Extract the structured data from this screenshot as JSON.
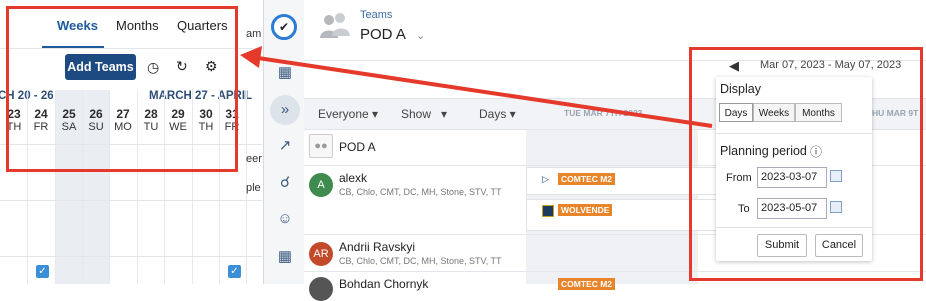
{
  "left_panel": {
    "tabs": [
      {
        "label": "Weeks",
        "active": true
      },
      {
        "label": "Months",
        "active": false
      },
      {
        "label": "Quarters",
        "active": false
      }
    ],
    "add_teams_label": "Add Teams",
    "icons": [
      "clock-icon",
      "refresh-icon",
      "gear-icon"
    ],
    "range_left": "CH 20 - 26",
    "range_right": "MARCH 27 - APRIL",
    "days": [
      {
        "n": "23",
        "w": "TH"
      },
      {
        "n": "24",
        "w": "FR"
      },
      {
        "n": "25",
        "w": "SA"
      },
      {
        "n": "26",
        "w": "SU"
      },
      {
        "n": "27",
        "w": "MO"
      },
      {
        "n": "28",
        "w": "TU"
      },
      {
        "n": "29",
        "w": "WE"
      },
      {
        "n": "30",
        "w": "TH"
      },
      {
        "n": "31",
        "w": "FR"
      }
    ],
    "edge_texts": [
      "am",
      "eer",
      "ple"
    ]
  },
  "sidebar": {
    "icons": [
      "app-logo-icon",
      "calendar-icon",
      "chevrons-right-icon",
      "chart-icon",
      "share-nodes-icon",
      "user-circle-icon",
      "grid-icon"
    ]
  },
  "header": {
    "breadcrumb": "Teams",
    "title": "POD A"
  },
  "date_range": "Mar 07, 2023 - May 07, 2023",
  "toolbar": {
    "everyone": "Everyone",
    "show": "Show",
    "days": "Days",
    "col_1": "TUE MAR 7TH 2023",
    "col_2": "HU MAR 9T"
  },
  "team_row": {
    "name": "POD A"
  },
  "people": [
    {
      "initial": "A",
      "name": "alexk",
      "skills": "CB, Chlo, CMT, DC, MH, Stone, STV, TT",
      "color": "#3f8a4f",
      "tags": [
        "COMTEC M2",
        "WOLVENDE"
      ]
    },
    {
      "initial": "AR",
      "name": "Andrii Ravskyi",
      "skills": "CB, Chlo, CMT, DC, MH, Stone, STV, TT",
      "color": "#c24a2a",
      "tags": []
    },
    {
      "initial": "",
      "name": "Bohdan Chornyk",
      "skills": "",
      "color": "#555",
      "tags": [
        "COMTEC M2"
      ]
    }
  ],
  "popup": {
    "display_label": "Display",
    "display_options": [
      {
        "label": "Days",
        "active": true
      },
      {
        "label": "Weeks",
        "active": false
      },
      {
        "label": "Months",
        "active": false
      }
    ],
    "planning_label": "Planning period",
    "from_label": "From",
    "from_value": "2023-03-07",
    "to_label": "To",
    "to_value": "2023-05-07",
    "submit_label": "Submit",
    "cancel_label": "Cancel"
  },
  "colors": {
    "annotation": "#e53a2b",
    "primary": "#1d4a80",
    "tag": "#e8842a"
  }
}
